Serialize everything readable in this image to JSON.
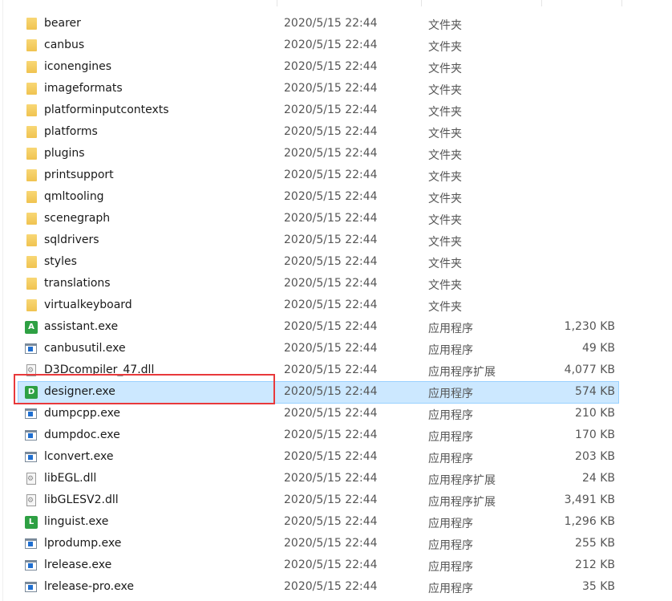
{
  "files": [
    {
      "name": "bearer",
      "date": "2020/5/15 22:44",
      "type": "文件夹",
      "size": "",
      "icon": "folder-icon"
    },
    {
      "name": "canbus",
      "date": "2020/5/15 22:44",
      "type": "文件夹",
      "size": "",
      "icon": "folder-icon"
    },
    {
      "name": "iconengines",
      "date": "2020/5/15 22:44",
      "type": "文件夹",
      "size": "",
      "icon": "folder-icon"
    },
    {
      "name": "imageformats",
      "date": "2020/5/15 22:44",
      "type": "文件夹",
      "size": "",
      "icon": "folder-icon"
    },
    {
      "name": "platforminputcontexts",
      "date": "2020/5/15 22:44",
      "type": "文件夹",
      "size": "",
      "icon": "folder-icon"
    },
    {
      "name": "platforms",
      "date": "2020/5/15 22:44",
      "type": "文件夹",
      "size": "",
      "icon": "folder-icon"
    },
    {
      "name": "plugins",
      "date": "2020/5/15 22:44",
      "type": "文件夹",
      "size": "",
      "icon": "folder-icon"
    },
    {
      "name": "printsupport",
      "date": "2020/5/15 22:44",
      "type": "文件夹",
      "size": "",
      "icon": "folder-icon"
    },
    {
      "name": "qmltooling",
      "date": "2020/5/15 22:44",
      "type": "文件夹",
      "size": "",
      "icon": "folder-icon"
    },
    {
      "name": "scenegraph",
      "date": "2020/5/15 22:44",
      "type": "文件夹",
      "size": "",
      "icon": "folder-icon"
    },
    {
      "name": "sqldrivers",
      "date": "2020/5/15 22:44",
      "type": "文件夹",
      "size": "",
      "icon": "folder-icon"
    },
    {
      "name": "styles",
      "date": "2020/5/15 22:44",
      "type": "文件夹",
      "size": "",
      "icon": "folder-icon"
    },
    {
      "name": "translations",
      "date": "2020/5/15 22:44",
      "type": "文件夹",
      "size": "",
      "icon": "folder-icon"
    },
    {
      "name": "virtualkeyboard",
      "date": "2020/5/15 22:44",
      "type": "文件夹",
      "size": "",
      "icon": "folder-icon"
    },
    {
      "name": "assistant.exe",
      "date": "2020/5/15 22:44",
      "type": "应用程序",
      "size": "1,230 KB",
      "icon": "assistant-app-icon",
      "letter": "A"
    },
    {
      "name": "canbusutil.exe",
      "date": "2020/5/15 22:44",
      "type": "应用程序",
      "size": "49 KB",
      "icon": "exe-icon"
    },
    {
      "name": "D3Dcompiler_47.dll",
      "date": "2020/5/15 22:44",
      "type": "应用程序扩展",
      "size": "4,077 KB",
      "icon": "dll-icon"
    },
    {
      "name": "designer.exe",
      "date": "2020/5/15 22:44",
      "type": "应用程序",
      "size": "574 KB",
      "icon": "designer-app-icon",
      "letter": "D",
      "selected": true
    },
    {
      "name": "dumpcpp.exe",
      "date": "2020/5/15 22:44",
      "type": "应用程序",
      "size": "210 KB",
      "icon": "exe-icon"
    },
    {
      "name": "dumpdoc.exe",
      "date": "2020/5/15 22:44",
      "type": "应用程序",
      "size": "170 KB",
      "icon": "exe-icon"
    },
    {
      "name": "lconvert.exe",
      "date": "2020/5/15 22:44",
      "type": "应用程序",
      "size": "203 KB",
      "icon": "exe-icon"
    },
    {
      "name": "libEGL.dll",
      "date": "2020/5/15 22:44",
      "type": "应用程序扩展",
      "size": "24 KB",
      "icon": "dll-icon"
    },
    {
      "name": "libGLESV2.dll",
      "date": "2020/5/15 22:44",
      "type": "应用程序扩展",
      "size": "3,491 KB",
      "icon": "dll-icon"
    },
    {
      "name": "linguist.exe",
      "date": "2020/5/15 22:44",
      "type": "应用程序",
      "size": "1,296 KB",
      "icon": "linguist-app-icon",
      "letter": "L"
    },
    {
      "name": "lprodump.exe",
      "date": "2020/5/15 22:44",
      "type": "应用程序",
      "size": "255 KB",
      "icon": "exe-icon"
    },
    {
      "name": "lrelease.exe",
      "date": "2020/5/15 22:44",
      "type": "应用程序",
      "size": "212 KB",
      "icon": "exe-icon"
    },
    {
      "name": "lrelease-pro.exe",
      "date": "2020/5/15 22:44",
      "type": "应用程序",
      "size": "35 KB",
      "icon": "exe-icon"
    }
  ],
  "colors": {
    "selection": "#cce8ff",
    "highlight_box": "#e8393b",
    "folder": "#f0c350",
    "qt_app": "#2ea043"
  }
}
